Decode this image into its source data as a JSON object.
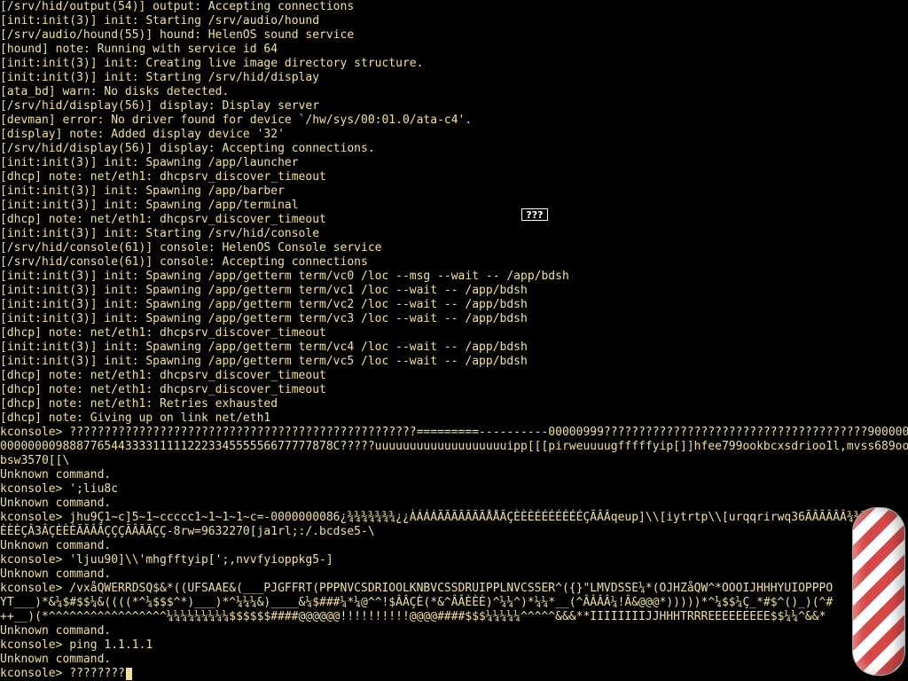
{
  "console": {
    "lines": [
      "[/srv/hid/output(54)] output: Accepting connections",
      "[init:init(3)] init: Starting /srv/audio/hound",
      "[/srv/audio/hound(55)] hound: HelenOS sound service",
      "[hound] note: Running with service id 64",
      "[init:init(3)] init: Creating live image directory structure.",
      "[init:init(3)] init: Starting /srv/hid/display",
      "[ata_bd] warn: No disks detected.",
      "[/srv/hid/display(56)] display: Display server",
      "[devman] error: No driver found for device `/hw/sys/00:01.0/ata-c4'.",
      "[display] note: Added display device '32'",
      "[/srv/hid/display(56)] display: Accepting connections.",
      "[init:init(3)] init: Spawning /app/launcher",
      "[dhcp] note: net/eth1: dhcpsrv_discover_timeout",
      "[init:init(3)] init: Spawning /app/barber",
      "[init:init(3)] init: Spawning /app/terminal",
      "[dhcp] note: net/eth1: dhcpsrv_discover_timeout",
      "[init:init(3)] init: Starting /srv/hid/console",
      "[/srv/hid/console(61)] console: HelenOS Console service",
      "[/srv/hid/console(61)] console: Accepting connections",
      "[init:init(3)] init: Spawning /app/getterm term/vc0 /loc --msg --wait -- /app/bdsh",
      "[init:init(3)] init: Spawning /app/getterm term/vc1 /loc --wait -- /app/bdsh",
      "[init:init(3)] init: Spawning /app/getterm term/vc2 /loc --wait -- /app/bdsh",
      "[init:init(3)] init: Spawning /app/getterm term/vc3 /loc --wait -- /app/bdsh",
      "[dhcp] note: net/eth1: dhcpsrv_discover_timeout",
      "[init:init(3)] init: Spawning /app/getterm term/vc4 /loc --wait -- /app/bdsh",
      "[init:init(3)] init: Spawning /app/getterm term/vc5 /loc --wait -- /app/bdsh",
      "[dhcp] note: net/eth1: dhcpsrv_discover_timeout",
      "[dhcp] note: net/eth1: dhcpsrv_discover_timeout",
      "[dhcp] note: net/eth1: Retries exhausted",
      "[dhcp] note: Giving up on link net/eth1",
      "kconsole> ??????????????????????????????????????????????????=========----------00000999??????????????????????????????????????9000000",
      "000000009888776544333311111222334555556677777878C?????uuuuuuuuuuuuuuuuuuuipp[[[pirweuuuugfffffyip[]]hfee799ookbcxsdrioo1l,mvss689ook",
      "bsw3570[[\\",
      "Unknown command.",
      "kconsole> ';liu8c",
      "Unknown command.",
      "kconsole> jhu9Ç1~c]5~1~ccccc1~1~1~1~c=-0000000086¿¾¾¾¾¾¾¾¿¿ÀÁÁÁÃÃÃÃÃÃÃÅÅÃÇÈÈÈÉÉÉÉÉÉÉÇÃÂÂqeup]\\\\[iytrtp\\\\[urqqrirwq36ÃÂÃÂÂÂ¾¾¾¾¾",
      "ÈÈÈÇÂ3ÂÇÈÈÈÃÃÂÃÇÇÇÃÂÃÃÇÇ-8rw=9632270[ja1rl;:/.bcdse5-\\",
      "Unknown command.",
      "kconsole> 'ljuu90]\\\\'mhgfftyip[';,nvvfyioppkg5-]",
      "Unknown command.",
      "kconsole> /vxåQWERRDSQ$&*((UFSAAE&(___PJGFFRT(PPPNVCSDRIOOLKNBVCSSDRUIPPLNVCSSER^({}\"LMVDSSE¼*(OJHZåQW^*OOOIJHHHYUIOPPPO",
      "YT___)*&¼$#$$¼&((((*^¼$$$^*)___)*^¼¼¼&)____&¼$###¼*¼@^^!$ÂÂÇÈ(*&^ÂÂÈÈÈ)^¼¼^)*¼¼*__(^ÂÂÂÂ¼!Â&@@@*)))))*^¼$$¼Ç_*#$^()_)(^#",
      "++__)(*^^^^^^^^^^^^^^^^^¼¼¼¼¼¼¼¼¼$$$$$$####@@@@@@!!!!!!!!!!@@@@####$$$¼¼¼¼¼^^^^^&&&**IIIIIIIIJJHHHTRRREEEEEEEEE$$¼¼^&&*",
      "Unknown command.",
      "kconsole> ping 1.1.1.1",
      "Unknown command.",
      "kconsole> ????????"
    ]
  },
  "popup": {
    "text": "???"
  },
  "colors": {
    "text": "#f0e0a0",
    "background": "#000000",
    "cursor": "#f0e0a0",
    "candy_stripe": "#d84848"
  },
  "icons": {
    "corner_graphic": "candy-cane-stripe-icon"
  }
}
